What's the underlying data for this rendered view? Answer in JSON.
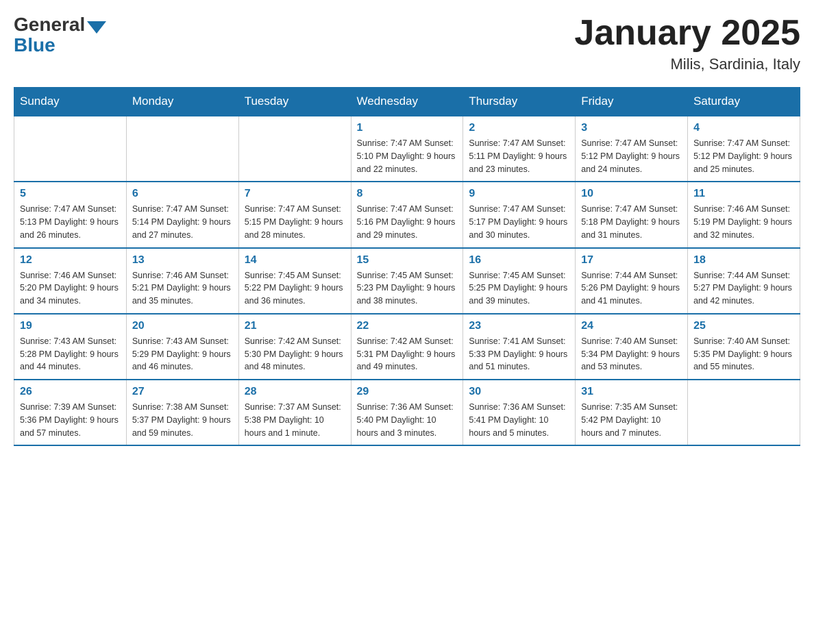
{
  "header": {
    "title": "January 2025",
    "location": "Milis, Sardinia, Italy",
    "logo_general": "General",
    "logo_blue": "Blue"
  },
  "days_of_week": [
    "Sunday",
    "Monday",
    "Tuesday",
    "Wednesday",
    "Thursday",
    "Friday",
    "Saturday"
  ],
  "weeks": [
    [
      {
        "day": "",
        "info": ""
      },
      {
        "day": "",
        "info": ""
      },
      {
        "day": "",
        "info": ""
      },
      {
        "day": "1",
        "info": "Sunrise: 7:47 AM\nSunset: 5:10 PM\nDaylight: 9 hours\nand 22 minutes."
      },
      {
        "day": "2",
        "info": "Sunrise: 7:47 AM\nSunset: 5:11 PM\nDaylight: 9 hours\nand 23 minutes."
      },
      {
        "day": "3",
        "info": "Sunrise: 7:47 AM\nSunset: 5:12 PM\nDaylight: 9 hours\nand 24 minutes."
      },
      {
        "day": "4",
        "info": "Sunrise: 7:47 AM\nSunset: 5:12 PM\nDaylight: 9 hours\nand 25 minutes."
      }
    ],
    [
      {
        "day": "5",
        "info": "Sunrise: 7:47 AM\nSunset: 5:13 PM\nDaylight: 9 hours\nand 26 minutes."
      },
      {
        "day": "6",
        "info": "Sunrise: 7:47 AM\nSunset: 5:14 PM\nDaylight: 9 hours\nand 27 minutes."
      },
      {
        "day": "7",
        "info": "Sunrise: 7:47 AM\nSunset: 5:15 PM\nDaylight: 9 hours\nand 28 minutes."
      },
      {
        "day": "8",
        "info": "Sunrise: 7:47 AM\nSunset: 5:16 PM\nDaylight: 9 hours\nand 29 minutes."
      },
      {
        "day": "9",
        "info": "Sunrise: 7:47 AM\nSunset: 5:17 PM\nDaylight: 9 hours\nand 30 minutes."
      },
      {
        "day": "10",
        "info": "Sunrise: 7:47 AM\nSunset: 5:18 PM\nDaylight: 9 hours\nand 31 minutes."
      },
      {
        "day": "11",
        "info": "Sunrise: 7:46 AM\nSunset: 5:19 PM\nDaylight: 9 hours\nand 32 minutes."
      }
    ],
    [
      {
        "day": "12",
        "info": "Sunrise: 7:46 AM\nSunset: 5:20 PM\nDaylight: 9 hours\nand 34 minutes."
      },
      {
        "day": "13",
        "info": "Sunrise: 7:46 AM\nSunset: 5:21 PM\nDaylight: 9 hours\nand 35 minutes."
      },
      {
        "day": "14",
        "info": "Sunrise: 7:45 AM\nSunset: 5:22 PM\nDaylight: 9 hours\nand 36 minutes."
      },
      {
        "day": "15",
        "info": "Sunrise: 7:45 AM\nSunset: 5:23 PM\nDaylight: 9 hours\nand 38 minutes."
      },
      {
        "day": "16",
        "info": "Sunrise: 7:45 AM\nSunset: 5:25 PM\nDaylight: 9 hours\nand 39 minutes."
      },
      {
        "day": "17",
        "info": "Sunrise: 7:44 AM\nSunset: 5:26 PM\nDaylight: 9 hours\nand 41 minutes."
      },
      {
        "day": "18",
        "info": "Sunrise: 7:44 AM\nSunset: 5:27 PM\nDaylight: 9 hours\nand 42 minutes."
      }
    ],
    [
      {
        "day": "19",
        "info": "Sunrise: 7:43 AM\nSunset: 5:28 PM\nDaylight: 9 hours\nand 44 minutes."
      },
      {
        "day": "20",
        "info": "Sunrise: 7:43 AM\nSunset: 5:29 PM\nDaylight: 9 hours\nand 46 minutes."
      },
      {
        "day": "21",
        "info": "Sunrise: 7:42 AM\nSunset: 5:30 PM\nDaylight: 9 hours\nand 48 minutes."
      },
      {
        "day": "22",
        "info": "Sunrise: 7:42 AM\nSunset: 5:31 PM\nDaylight: 9 hours\nand 49 minutes."
      },
      {
        "day": "23",
        "info": "Sunrise: 7:41 AM\nSunset: 5:33 PM\nDaylight: 9 hours\nand 51 minutes."
      },
      {
        "day": "24",
        "info": "Sunrise: 7:40 AM\nSunset: 5:34 PM\nDaylight: 9 hours\nand 53 minutes."
      },
      {
        "day": "25",
        "info": "Sunrise: 7:40 AM\nSunset: 5:35 PM\nDaylight: 9 hours\nand 55 minutes."
      }
    ],
    [
      {
        "day": "26",
        "info": "Sunrise: 7:39 AM\nSunset: 5:36 PM\nDaylight: 9 hours\nand 57 minutes."
      },
      {
        "day": "27",
        "info": "Sunrise: 7:38 AM\nSunset: 5:37 PM\nDaylight: 9 hours\nand 59 minutes."
      },
      {
        "day": "28",
        "info": "Sunrise: 7:37 AM\nSunset: 5:38 PM\nDaylight: 10 hours\nand 1 minute."
      },
      {
        "day": "29",
        "info": "Sunrise: 7:36 AM\nSunset: 5:40 PM\nDaylight: 10 hours\nand 3 minutes."
      },
      {
        "day": "30",
        "info": "Sunrise: 7:36 AM\nSunset: 5:41 PM\nDaylight: 10 hours\nand 5 minutes."
      },
      {
        "day": "31",
        "info": "Sunrise: 7:35 AM\nSunset: 5:42 PM\nDaylight: 10 hours\nand 7 minutes."
      },
      {
        "day": "",
        "info": ""
      }
    ]
  ]
}
